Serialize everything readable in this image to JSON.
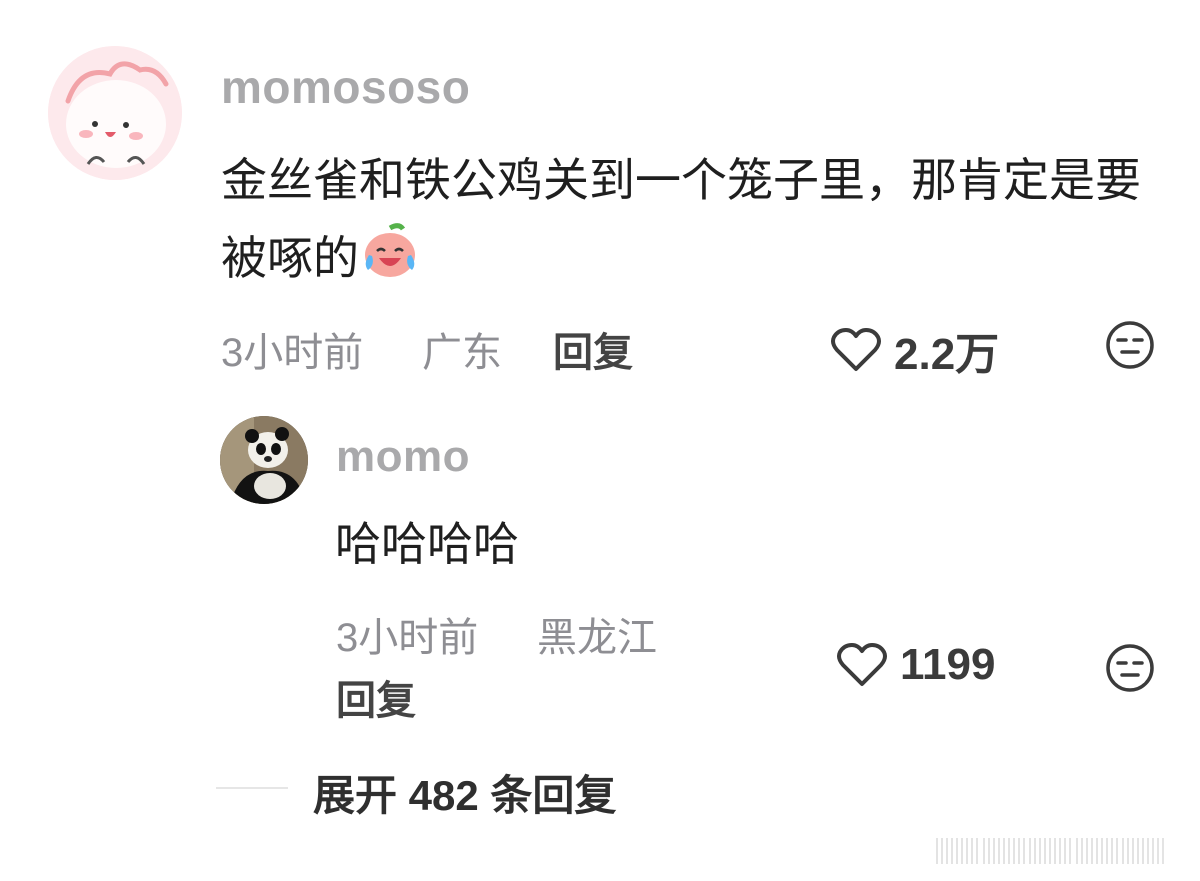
{
  "comments": [
    {
      "username": "momososo",
      "text": "金丝雀和铁公鸡关到一个笼子里，那肯定是要被啄的",
      "emoji_icon": "crying-laughing-peach-icon",
      "time": "3小时前",
      "location": "广东",
      "reply_label": "回复",
      "likes": "2.2万"
    },
    {
      "username": "momo",
      "text": "哈哈哈哈",
      "time": "3小时前",
      "location": "黑龙江",
      "reply_label": "回复",
      "likes": "1199"
    }
  ],
  "expand_replies": "展开 482 条回复",
  "colors": {
    "username": "#a9a9ab",
    "text": "#1f1f1f",
    "meta": "#8e8e93",
    "avatar_bg": "#fde7ea"
  }
}
